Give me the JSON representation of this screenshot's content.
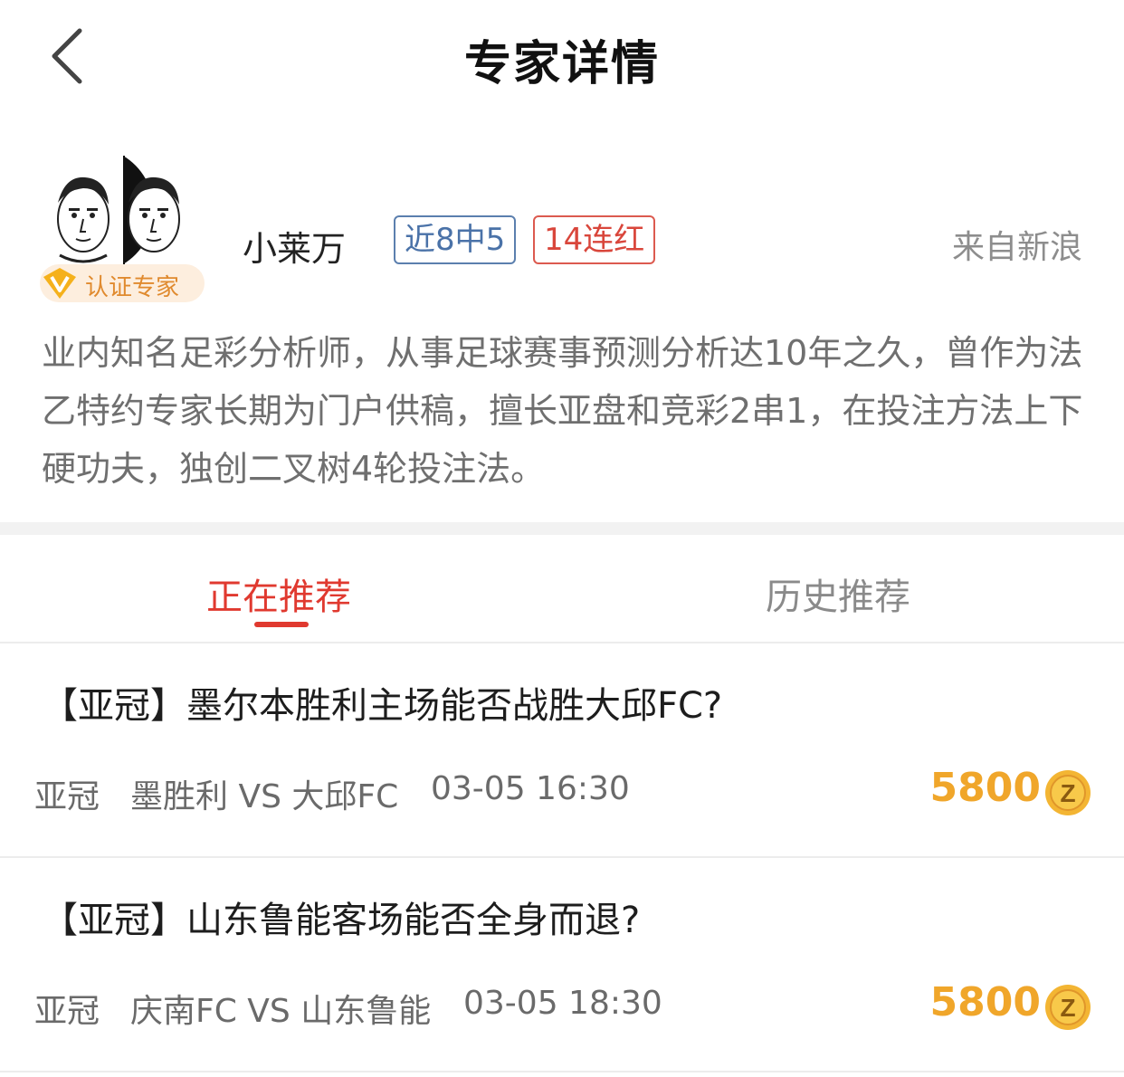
{
  "nav": {
    "title": "专家详情",
    "back_icon": "chevron-left-icon"
  },
  "expert": {
    "name": "小莱万",
    "badge": "认证专家",
    "tags": [
      "近8中5",
      "14连红"
    ],
    "source": "来自新浪",
    "bio": "业内知名足彩分析师，从事足球赛事预测分析达10年之久，曾作为法乙特约专家长期为门户供稿，擅长亚盘和竞彩2串1，在投注方法上下硬功夫，独创二叉树4轮投注法。"
  },
  "tabs": [
    {
      "label": "正在推荐",
      "active": true
    },
    {
      "label": "历史推荐",
      "active": false
    }
  ],
  "recommendations": [
    {
      "title": "【亚冠】墨尔本胜利主场能否战胜大邱FC?",
      "league": "亚冠",
      "match": "墨胜利 VS 大邱FC",
      "time": "03-05 16:30",
      "price": "5800"
    },
    {
      "title": "【亚冠】山东鲁能客场能否全身而退?",
      "league": "亚冠",
      "match": "庆南FC VS 山东鲁能",
      "time": "03-05 18:30",
      "price": "5800"
    }
  ],
  "colors": {
    "accent": "#e0392f",
    "coin": "#f0a62a",
    "tag_blue": "#4a72a8",
    "tag_red": "#d9463b"
  }
}
